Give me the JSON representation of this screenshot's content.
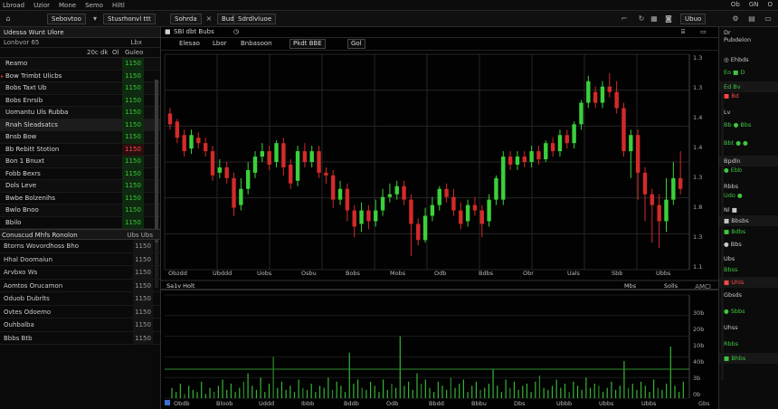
{
  "menubar": {
    "items": [
      "Lbroad",
      "Uzior",
      "Mone",
      "Semo",
      "Hiltl"
    ],
    "right_items": [
      "Ob",
      "GN",
      "O"
    ]
  },
  "toolbar": {
    "btn1": "Sebovtoo",
    "btn2": "Stusrhonvl ttt",
    "btn3": "Sohrda",
    "btn4": "Budd",
    "btn5": "Sdrdlvluoe",
    "btn6": "Ubuo"
  },
  "watchlist": {
    "title": "Udessa Wunt Ulore",
    "sub_left": "Lonbvor 65",
    "sub_right": "Lbx",
    "head_a": "20c dk",
    "head_b": "Ol",
    "head_c": "Guleo",
    "rows": [
      {
        "sym": "Reamo",
        "val": "1150",
        "mark": "",
        "dir": "up"
      },
      {
        "sym": "Bow Trimbt Ulicbs",
        "val": "1150",
        "mark": "▸",
        "dir": "up"
      },
      {
        "sym": "Bobs Taxt Ub",
        "val": "1150",
        "mark": "",
        "dir": "up"
      },
      {
        "sym": "Bobs Enrsib",
        "val": "1150",
        "mark": "",
        "dir": "up"
      },
      {
        "sym": "Uomantu Uls Rubba",
        "val": "1150",
        "mark": "",
        "dir": "up"
      },
      {
        "sym": "Rnah Sleadsatcs",
        "val": "1150",
        "mark": "",
        "dir": "up",
        "sel": true
      },
      {
        "sym": "Bnsb Bow",
        "val": "1150",
        "mark": "",
        "dir": "up"
      },
      {
        "sym": "Bb Rebitt Stotion",
        "val": "1150",
        "mark": "",
        "dir": "down"
      },
      {
        "sym": "Bon 1 Bnuxt",
        "val": "1150",
        "mark": "",
        "dir": "up"
      },
      {
        "sym": "Fobb Bexrs",
        "val": "1150",
        "mark": "",
        "dir": "up"
      },
      {
        "sym": "Dols Leve",
        "val": "1150",
        "mark": "",
        "dir": "up"
      },
      {
        "sym": "Bwbe Bolzenihs",
        "val": "1150",
        "mark": "",
        "dir": "up"
      },
      {
        "sym": "Bwlo Bnoo",
        "val": "1150",
        "mark": "",
        "dir": "up"
      },
      {
        "sym": "Bbilo",
        "val": "1150",
        "mark": "",
        "dir": "up"
      }
    ]
  },
  "timesales": {
    "title": "Conuscud Mhfs Ronolon",
    "right": "Ubs Ubs",
    "rows": [
      {
        "a": "Btorns Wovordhoss Bho",
        "b": "1150"
      },
      {
        "a": "Hhal Doomaiun",
        "b": "1150"
      },
      {
        "a": "Arvbxo Ws",
        "b": "1150"
      },
      {
        "a": "Aomtos Orucamon",
        "b": "1150"
      },
      {
        "a": "Oduob Dubrlts",
        "b": "1150"
      },
      {
        "a": "Ovtes Odoemo",
        "b": "1150"
      },
      {
        "a": "Ouhbalba",
        "b": "1150"
      },
      {
        "a": "Bbbs Btb",
        "b": "1150"
      }
    ]
  },
  "chart": {
    "tab1": "SBI dbt Bubs",
    "tab2": "Elesao",
    "tab3": "Lbor",
    "tab4": "Bnbasoon",
    "tab5": "Pkdt BBE",
    "sub_tab": "Gol",
    "corner_right": "AMCI",
    "vol_header": "Sa1v Holt",
    "vol_right1": "Mbs",
    "vol_right2": "Solls",
    "vol_far": "Gbs",
    "price_labels": [
      "1.3",
      "1.3",
      "1.4",
      "1.4",
      "1.3",
      "1.8",
      "1.3",
      "1.1"
    ],
    "time_labels": [
      "Obzdd",
      "Ubddd",
      "Uobs",
      "Osbu",
      "Bobs",
      "Mobs",
      "Odb",
      "Bdbs",
      "Obr",
      "Uals",
      "Sbb",
      "Ubbs"
    ],
    "vol_time_labels": [
      "Obdb",
      "Bloob",
      "Uddd",
      "Ibbb",
      "Bddb",
      "Odb",
      "Bbdd",
      "Bbbu",
      "Dbs",
      "Ubbb",
      "Ubbs",
      "Ubbs"
    ],
    "vol_scale_labels": [
      "30b",
      "20b",
      "10b",
      "40b",
      "3b",
      "0b"
    ]
  },
  "chart_data": {
    "type": "candlestick",
    "candles": [
      {
        "o": 58,
        "c": 54,
        "h": 60,
        "l": 52
      },
      {
        "o": 55,
        "c": 49,
        "h": 56,
        "l": 47
      },
      {
        "o": 50,
        "c": 44,
        "h": 52,
        "l": 42
      },
      {
        "o": 45,
        "c": 50,
        "h": 52,
        "l": 43
      },
      {
        "o": 49,
        "c": 47,
        "h": 51,
        "l": 45
      },
      {
        "o": 47,
        "c": 44,
        "h": 49,
        "l": 42
      },
      {
        "o": 44,
        "c": 35,
        "h": 46,
        "l": 33
      },
      {
        "o": 36,
        "c": 38,
        "h": 41,
        "l": 34
      },
      {
        "o": 38,
        "c": 34,
        "h": 40,
        "l": 32
      },
      {
        "o": 34,
        "c": 23,
        "h": 36,
        "l": 20
      },
      {
        "o": 24,
        "c": 30,
        "h": 34,
        "l": 22
      },
      {
        "o": 30,
        "c": 37,
        "h": 40,
        "l": 28
      },
      {
        "o": 36,
        "c": 42,
        "h": 44,
        "l": 34
      },
      {
        "o": 42,
        "c": 44,
        "h": 47,
        "l": 40
      },
      {
        "o": 44,
        "c": 39,
        "h": 46,
        "l": 37
      },
      {
        "o": 40,
        "c": 47,
        "h": 48,
        "l": 38
      },
      {
        "o": 47,
        "c": 38,
        "h": 49,
        "l": 35
      },
      {
        "o": 39,
        "c": 32,
        "h": 41,
        "l": 30
      },
      {
        "o": 33,
        "c": 44,
        "h": 46,
        "l": 31
      },
      {
        "o": 44,
        "c": 40,
        "h": 47,
        "l": 38
      },
      {
        "o": 40,
        "c": 44,
        "h": 46,
        "l": 38
      },
      {
        "o": 44,
        "c": 36,
        "h": 46,
        "l": 34
      },
      {
        "o": 36,
        "c": 35,
        "h": 38,
        "l": 32
      },
      {
        "o": 35,
        "c": 26,
        "h": 37,
        "l": 23
      },
      {
        "o": 26,
        "c": 30,
        "h": 33,
        "l": 24
      },
      {
        "o": 30,
        "c": 22,
        "h": 32,
        "l": 18
      },
      {
        "o": 22,
        "c": 16,
        "h": 24,
        "l": 12
      },
      {
        "o": 17,
        "c": 22,
        "h": 25,
        "l": 14
      },
      {
        "o": 22,
        "c": 18,
        "h": 24,
        "l": 15
      },
      {
        "o": 18,
        "c": 22,
        "h": 26,
        "l": 16
      },
      {
        "o": 22,
        "c": 27,
        "h": 30,
        "l": 20
      },
      {
        "o": 27,
        "c": 28,
        "h": 32,
        "l": 25
      },
      {
        "o": 28,
        "c": 31,
        "h": 33,
        "l": 26
      },
      {
        "o": 31,
        "c": 26,
        "h": 33,
        "l": 24
      },
      {
        "o": 26,
        "c": 17,
        "h": 28,
        "l": 5
      },
      {
        "o": 17,
        "c": 11,
        "h": 19,
        "l": 9
      },
      {
        "o": 11,
        "c": 20,
        "h": 23,
        "l": 10
      },
      {
        "o": 20,
        "c": 24,
        "h": 27,
        "l": 18
      },
      {
        "o": 24,
        "c": 30,
        "h": 31,
        "l": 22
      },
      {
        "o": 30,
        "c": 27,
        "h": 32,
        "l": 25
      },
      {
        "o": 27,
        "c": 22,
        "h": 30,
        "l": 20
      },
      {
        "o": 22,
        "c": 17,
        "h": 25,
        "l": 15
      },
      {
        "o": 18,
        "c": 24,
        "h": 26,
        "l": 16
      },
      {
        "o": 24,
        "c": 22,
        "h": 27,
        "l": 20
      },
      {
        "o": 22,
        "c": 17,
        "h": 24,
        "l": 12
      },
      {
        "o": 18,
        "c": 26,
        "h": 28,
        "l": 16
      },
      {
        "o": 26,
        "c": 34,
        "h": 35,
        "l": 24
      },
      {
        "o": 26,
        "c": 42,
        "h": 44,
        "l": 24
      },
      {
        "o": 42,
        "c": 39,
        "h": 44,
        "l": 37
      },
      {
        "o": 39,
        "c": 42,
        "h": 44,
        "l": 37
      },
      {
        "o": 42,
        "c": 40,
        "h": 44,
        "l": 38
      },
      {
        "o": 40,
        "c": 44,
        "h": 46,
        "l": 38
      },
      {
        "o": 44,
        "c": 41,
        "h": 46,
        "l": 39
      },
      {
        "o": 41,
        "c": 47,
        "h": 48,
        "l": 40
      },
      {
        "o": 47,
        "c": 44,
        "h": 49,
        "l": 42
      },
      {
        "o": 44,
        "c": 50,
        "h": 52,
        "l": 42
      },
      {
        "o": 50,
        "c": 47,
        "h": 52,
        "l": 45
      },
      {
        "o": 47,
        "c": 54,
        "h": 55,
        "l": 45
      },
      {
        "o": 54,
        "c": 62,
        "h": 63,
        "l": 52
      },
      {
        "o": 62,
        "c": 70,
        "h": 72,
        "l": 60
      },
      {
        "o": 66,
        "c": 62,
        "h": 68,
        "l": 60
      },
      {
        "o": 62,
        "c": 68,
        "h": 70,
        "l": 60
      },
      {
        "o": 68,
        "c": 66,
        "h": 73,
        "l": 64
      },
      {
        "o": 66,
        "c": 60,
        "h": 70,
        "l": 58
      },
      {
        "o": 60,
        "c": 44,
        "h": 62,
        "l": 42
      },
      {
        "o": 44,
        "c": 50,
        "h": 52,
        "l": 34
      },
      {
        "o": 50,
        "c": 36,
        "h": 52,
        "l": 26
      },
      {
        "o": 36,
        "c": 28,
        "h": 38,
        "l": 18
      },
      {
        "o": 28,
        "c": 24,
        "h": 30,
        "l": 10
      },
      {
        "o": 24,
        "c": 18,
        "h": 28,
        "l": 8
      },
      {
        "o": 18,
        "c": 26,
        "h": 34,
        "l": 14
      },
      {
        "o": 26,
        "c": 34,
        "h": 40,
        "l": 24
      },
      {
        "o": 34,
        "c": 30,
        "h": 44,
        "l": 28
      }
    ],
    "volumes": [
      5,
      3,
      7,
      2,
      6,
      4,
      3,
      8,
      2,
      5,
      3,
      6,
      9,
      4,
      7,
      3,
      5,
      8,
      12,
      6,
      4,
      10,
      3,
      7,
      20,
      5,
      8,
      4,
      6,
      3,
      9,
      5,
      4,
      7,
      3,
      6,
      5,
      10,
      4,
      8,
      6,
      3,
      22,
      7,
      9,
      5,
      4,
      8,
      6,
      3,
      9,
      4,
      7,
      5,
      30,
      6,
      8,
      4,
      12,
      7,
      9,
      5,
      3,
      8,
      6,
      4,
      10,
      5,
      7,
      9,
      3,
      6,
      8,
      4,
      5,
      7,
      14,
      6,
      3,
      9,
      5,
      8,
      4,
      6,
      7,
      3,
      8,
      11,
      5,
      4,
      6,
      9,
      5,
      7,
      3,
      8,
      6,
      4,
      10,
      5,
      7,
      6,
      3,
      5,
      8,
      4,
      6,
      18,
      5,
      7,
      4,
      8,
      6,
      3,
      9,
      5,
      4,
      7,
      25,
      6,
      3,
      8
    ],
    "volume_colors": [
      "g",
      "r"
    ],
    "ylim": [
      0,
      80
    ],
    "vol_ylim": [
      0,
      50
    ]
  },
  "right_panel": {
    "top": "Dr",
    "items": [
      {
        "t": "Pubdelon",
        "c": ""
      },
      {
        "t": "◎ Ehbds",
        "c": ""
      },
      {
        "t": "Eo ■ D",
        "c": "g"
      },
      {
        "t": "Ed Bv",
        "c": "g"
      },
      {
        "t": "■ Bd",
        "c": "r"
      },
      {
        "t": "Lv",
        "c": ""
      },
      {
        "t": "Bb ● Bbs",
        "c": "g"
      },
      {
        "t": "Bbt ● ●",
        "c": "g"
      },
      {
        "t": "Bpdln",
        "c": ""
      },
      {
        "t": "● Ebb",
        "c": "g"
      },
      {
        "t": "Rbbs",
        "c": ""
      },
      {
        "t": "Udo ●",
        "c": "g"
      },
      {
        "t": "Nl ■",
        "c": ""
      },
      {
        "t": "■ Bbsbs",
        "c": ""
      },
      {
        "t": "■ Bdbs",
        "c": "g"
      },
      {
        "t": "● Bbs",
        "c": ""
      },
      {
        "t": "Ubs",
        "c": ""
      },
      {
        "t": "Bbss",
        "c": "g"
      },
      {
        "t": "■ Uhls",
        "c": "r"
      },
      {
        "t": "Gbsds",
        "c": ""
      },
      {
        "t": "● Sbbs",
        "c": "g"
      },
      {
        "t": "Uhss",
        "c": ""
      },
      {
        "t": "Rbbs",
        "c": "g"
      },
      {
        "t": "■ Bhbs",
        "c": "g"
      }
    ]
  }
}
